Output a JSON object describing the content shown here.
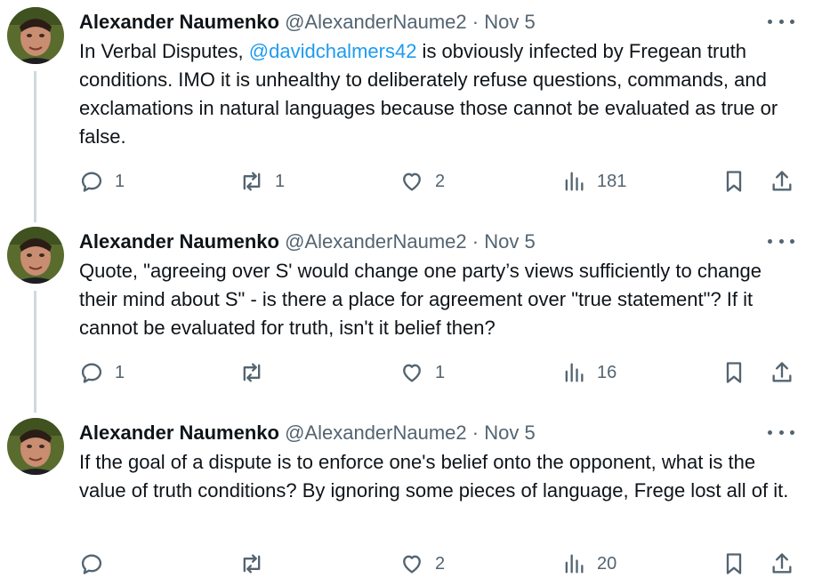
{
  "tweets": [
    {
      "name": "Alexander Naumenko",
      "handle": "@AlexanderNaume2",
      "separator": "·",
      "date": "Nov 5",
      "text_before": "In Verbal Disputes, ",
      "mention": "@davidchalmers42",
      "text_after": " is obviously infected by Fregean truth conditions. IMO it is unhealthy to deliberately refuse questions, commands, and exclamations in natural languages because those cannot be evaluated as true or false.",
      "replies": "1",
      "reposts": "1",
      "likes": "2",
      "views": "181"
    },
    {
      "name": "Alexander Naumenko",
      "handle": "@AlexanderNaume2",
      "separator": "·",
      "date": "Nov 5",
      "text": "Quote, \"agreeing over S' would change one party’s views sufficiently to change their mind about S\" - is there a place for agreement over \"true statement\"? If it cannot be evaluated for truth, isn't it belief then?",
      "replies": "1",
      "reposts": "",
      "likes": "1",
      "views": "16"
    },
    {
      "name": "Alexander Naumenko",
      "handle": "@AlexanderNaume2",
      "separator": "·",
      "date": "Nov 5",
      "text": "If the goal of a dispute is to enforce one's belief onto the opponent, what is the value of truth conditions? By ignoring some pieces of language, Frege lost all of it.",
      "replies": "",
      "reposts": "",
      "likes": "2",
      "views": "20"
    }
  ],
  "icons": [
    "reply-icon",
    "repost-icon",
    "like-icon",
    "views-icon",
    "bookmark-icon",
    "share-icon",
    "more-icon"
  ],
  "colors": {
    "text": "#0f1419",
    "secondary": "#536471",
    "link": "#1d9bf0",
    "thread_line": "#cfd9de"
  }
}
